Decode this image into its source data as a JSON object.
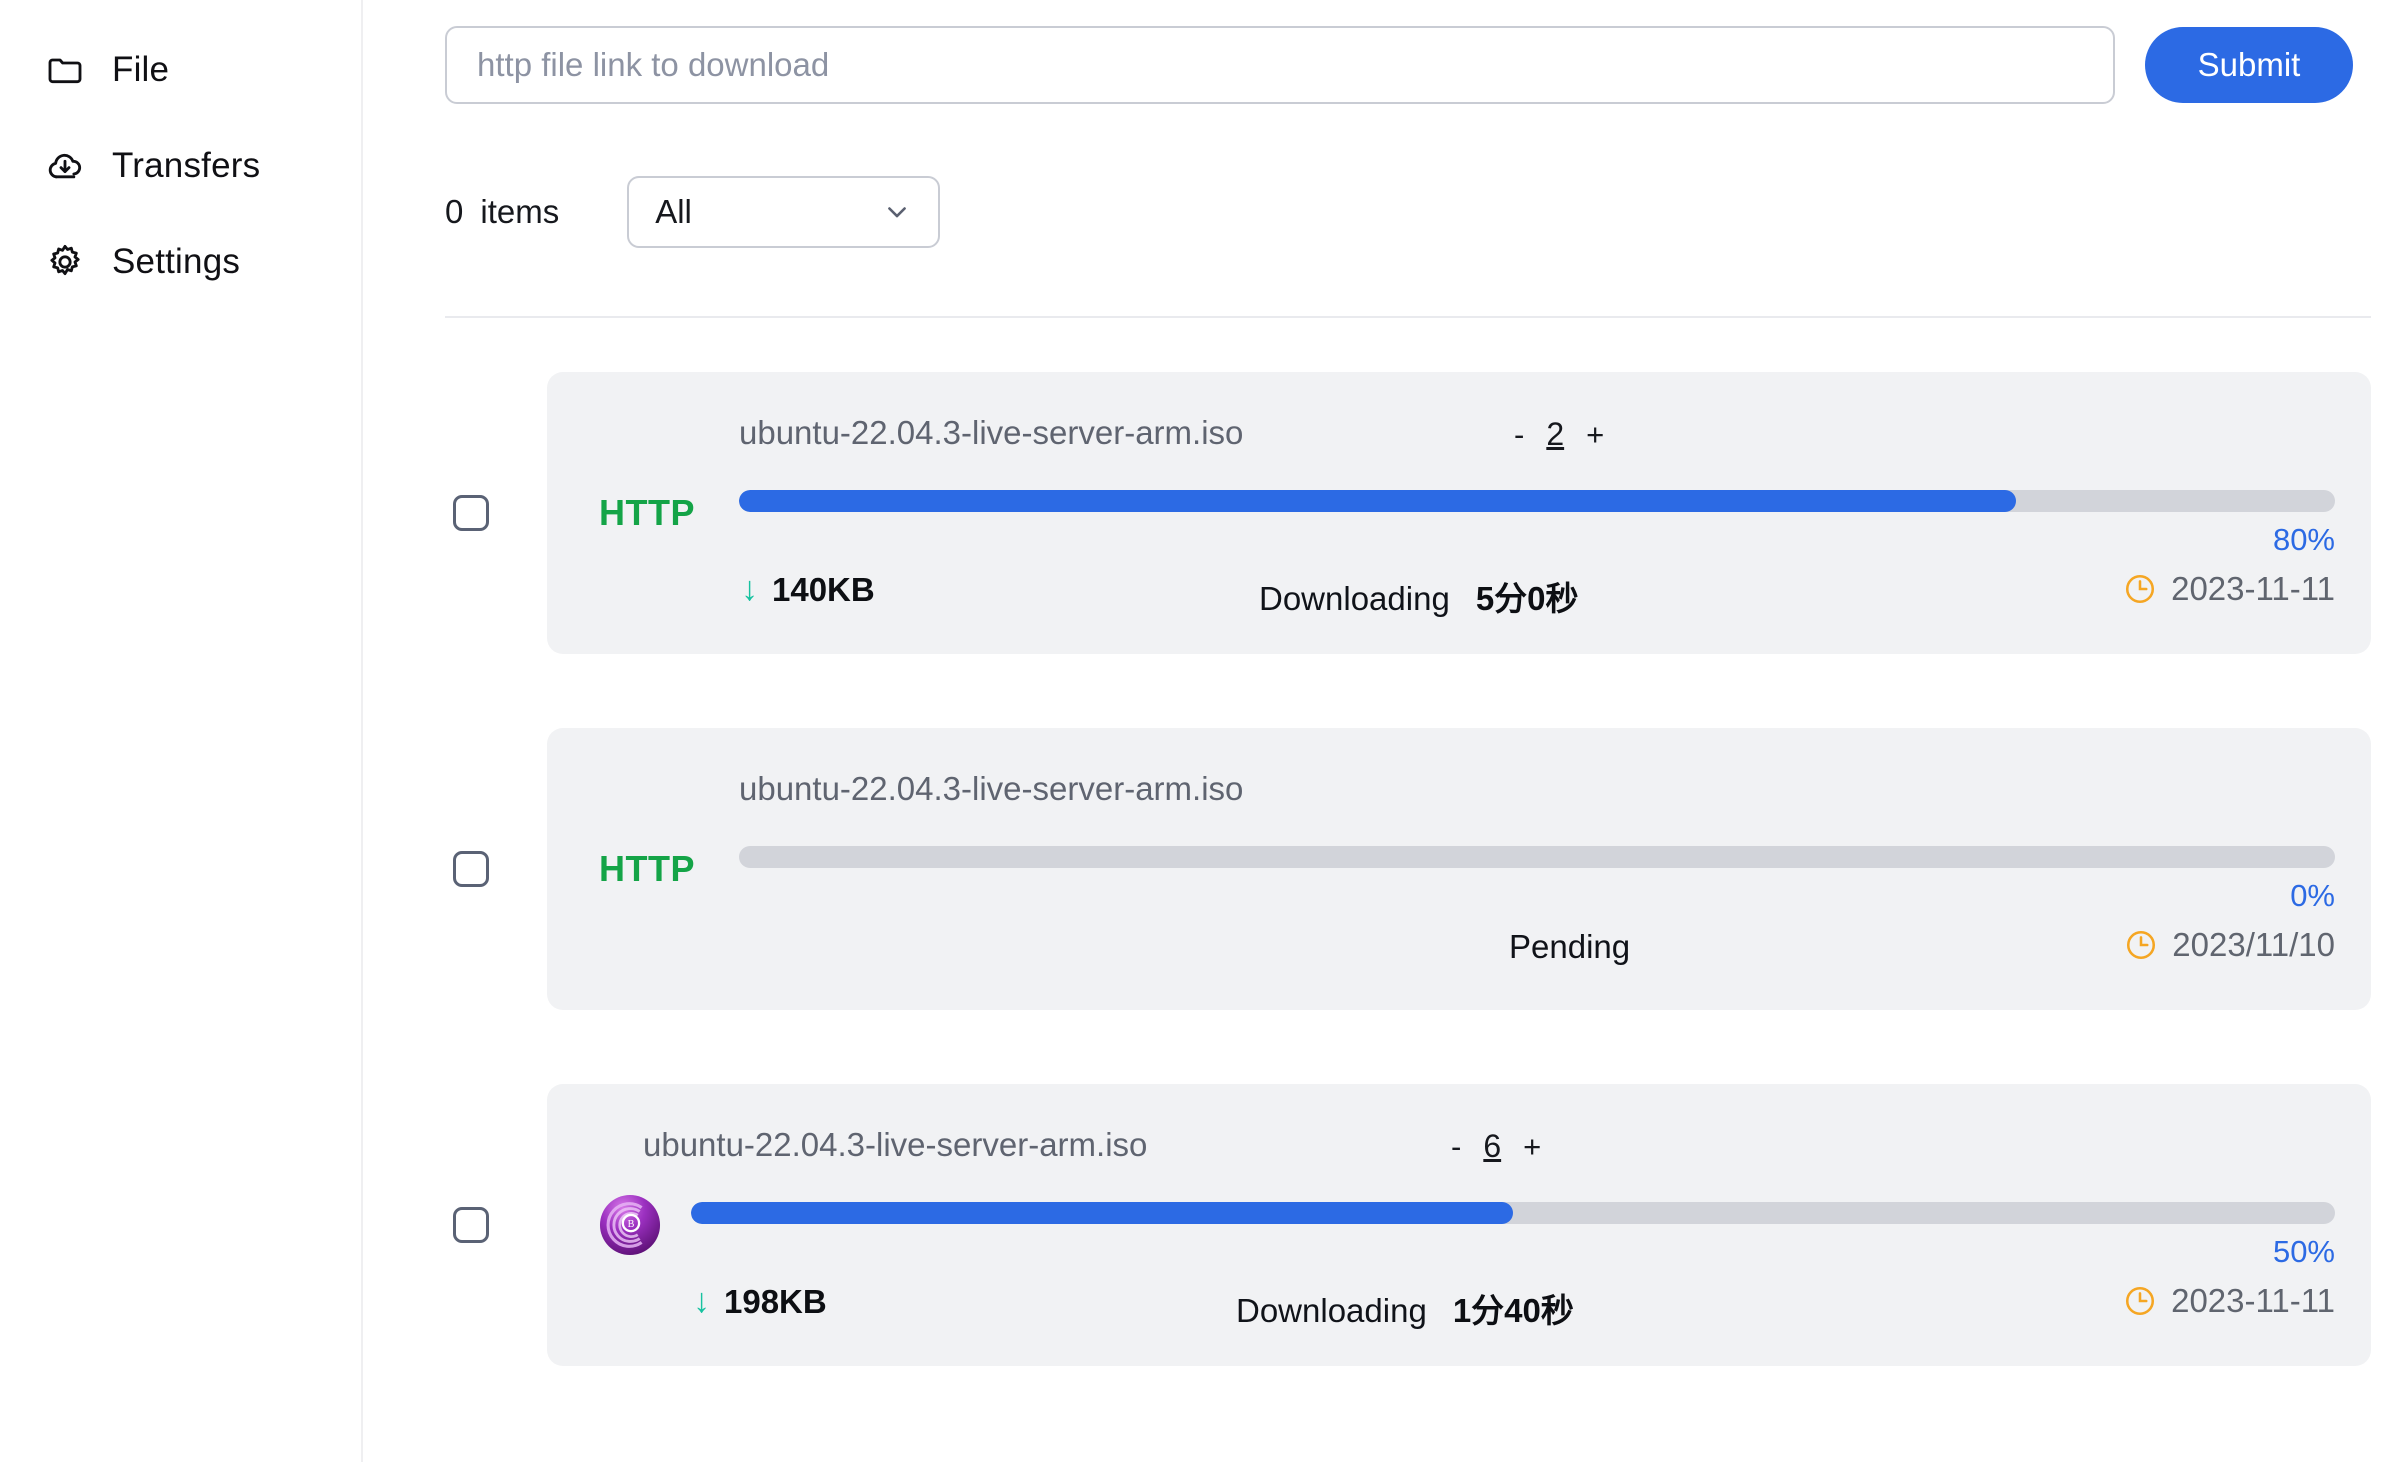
{
  "sidebar": {
    "items": [
      {
        "label": "File",
        "icon": "folder-icon"
      },
      {
        "label": "Transfers",
        "icon": "cloud-download-icon"
      },
      {
        "label": "Settings",
        "icon": "gear-icon"
      }
    ]
  },
  "topbar": {
    "url_placeholder": "http file link to download",
    "url_value": "",
    "submit_label": "Submit"
  },
  "filter": {
    "count": "0",
    "items_label": "items",
    "selected": "All",
    "options": [
      "All"
    ]
  },
  "downloads": [
    {
      "protocol_label": "HTTP",
      "protocol_icon": "http-label",
      "filename": "ubuntu-22.04.3-live-server-arm.iso",
      "stepper": {
        "minus": "-",
        "value": "2",
        "plus": "+"
      },
      "progress_pct": 80,
      "progress_label": "80%",
      "speed": "140KB",
      "speed_arrow": "↓",
      "status": "Downloading",
      "eta": "5分0秒",
      "date": "2023-11-11"
    },
    {
      "protocol_label": "HTTP",
      "protocol_icon": "http-label",
      "filename": "ubuntu-22.04.3-live-server-arm.iso",
      "stepper": null,
      "progress_pct": 0,
      "progress_label": "0%",
      "speed": "",
      "speed_arrow": "",
      "status": "Pending",
      "eta": "",
      "date": "2023/11/10"
    },
    {
      "protocol_label": "",
      "protocol_icon": "bittorrent-icon",
      "filename": "ubuntu-22.04.3-live-server-arm.iso",
      "stepper": {
        "minus": "-",
        "value": "6",
        "plus": "+"
      },
      "progress_pct": 50,
      "progress_label": "50%",
      "speed": "198KB",
      "speed_arrow": "↓",
      "status": "Downloading",
      "eta": "1分40秒",
      "date": "2023-11-11"
    }
  ],
  "colors": {
    "accent_blue": "#2c6ae4",
    "http_green": "#14a447",
    "speed_teal": "#17c2a0",
    "clock_orange": "#f5a623",
    "card_bg": "#f1f2f4",
    "track_gray": "#d2d4da"
  }
}
